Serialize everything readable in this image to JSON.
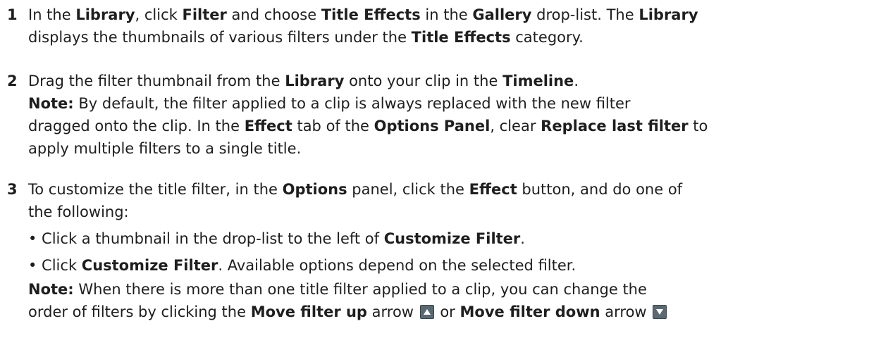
{
  "steps": [
    {
      "number": "1",
      "lines": [
        [
          {
            "t": "In the ",
            "b": false
          },
          {
            "t": "Library",
            "b": true
          },
          {
            "t": ", click ",
            "b": false
          },
          {
            "t": "Filter",
            "b": true
          },
          {
            "t": " and choose ",
            "b": false
          },
          {
            "t": "Title Effects",
            "b": true
          },
          {
            "t": " in the ",
            "b": false
          },
          {
            "t": "Gallery",
            "b": true
          },
          {
            "t": " drop-list. The ",
            "b": false
          },
          {
            "t": "Library",
            "b": true
          }
        ],
        [
          {
            "t": "displays the thumbnails of various filters under the ",
            "b": false
          },
          {
            "t": "Title Effects",
            "b": true
          },
          {
            "t": " category.",
            "b": false
          }
        ]
      ]
    },
    {
      "number": "2",
      "lines": [
        [
          {
            "t": "Drag the filter thumbnail from the ",
            "b": false
          },
          {
            "t": "Library",
            "b": true
          },
          {
            "t": " onto your clip in the ",
            "b": false
          },
          {
            "t": "Timeline",
            "b": true
          },
          {
            "t": ".",
            "b": false
          }
        ],
        [
          {
            "t": "Note:",
            "b": true
          },
          {
            "t": "  By default, the filter applied to a clip is always replaced with the new filter",
            "b": false
          }
        ],
        [
          {
            "t": "dragged onto the clip. In the ",
            "b": false
          },
          {
            "t": "Effect",
            "b": true
          },
          {
            "t": " tab of the ",
            "b": false
          },
          {
            "t": "Options Panel",
            "b": true
          },
          {
            "t": ", clear ",
            "b": false
          },
          {
            "t": "Replace last filter",
            "b": true
          },
          {
            "t": " to",
            "b": false
          }
        ],
        [
          {
            "t": "apply multiple filters to a single title.",
            "b": false
          }
        ]
      ]
    },
    {
      "number": "3",
      "lines": [
        [
          {
            "t": "To customize the title filter, in the ",
            "b": false
          },
          {
            "t": "Options",
            "b": true
          },
          {
            "t": " panel, click the ",
            "b": false
          },
          {
            "t": "Effect",
            "b": true
          },
          {
            "t": " button, and do one of",
            "b": false
          }
        ],
        [
          {
            "t": "the following:",
            "b": false
          }
        ],
        [
          {
            "t": "• Click a thumbnail in the drop-list to the left of ",
            "b": false
          },
          {
            "t": "Customize Filter",
            "b": true
          },
          {
            "t": ".",
            "b": false
          }
        ],
        [
          {
            "t": "• Click ",
            "b": false
          },
          {
            "t": "Customize Filter",
            "b": true
          },
          {
            "t": ". Available options depend on the selected filter.",
            "b": false
          }
        ],
        [
          {
            "t": "Note:",
            "b": true
          },
          {
            "t": "  When there is more than one title filter applied to a clip, you can change the",
            "b": false
          }
        ],
        [
          {
            "t": "order of filters by clicking the ",
            "b": false
          },
          {
            "t": "Move filter up",
            "b": true
          },
          {
            "t": " arrow ",
            "b": false
          },
          {
            "icon": "move-filter-up-icon"
          },
          {
            "t": " or ",
            "b": false
          },
          {
            "t": "Move filter down",
            "b": true
          },
          {
            "t": " arrow ",
            "b": false
          },
          {
            "icon": "move-filter-down-icon"
          }
        ]
      ]
    }
  ],
  "colors": {
    "text": "#1e1e1e",
    "icon_fill": "#5a6a72",
    "icon_arrow": "#ffffff"
  }
}
